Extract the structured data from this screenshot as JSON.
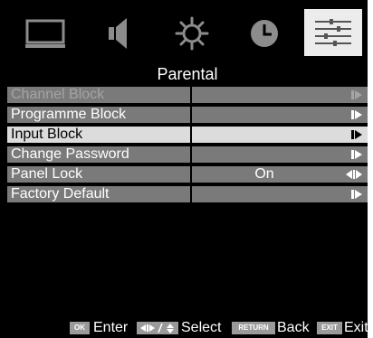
{
  "tabs": [
    {
      "icon": "picture-icon",
      "active": false
    },
    {
      "icon": "sound-icon",
      "active": false
    },
    {
      "icon": "settings-icon",
      "active": false
    },
    {
      "icon": "clock-icon",
      "active": false
    },
    {
      "icon": "options-icon",
      "active": true
    }
  ],
  "title": "Parental",
  "menu": {
    "items": [
      {
        "label": "Channel Block",
        "value": "",
        "state": "disabled"
      },
      {
        "label": "Programme Block",
        "value": "",
        "state": "normal"
      },
      {
        "label": "Input Block",
        "value": "",
        "state": "selected"
      },
      {
        "label": "Change Password",
        "value": "",
        "state": "normal"
      },
      {
        "label": "Panel Lock",
        "value": "On",
        "state": "normal"
      },
      {
        "label": "Factory Default",
        "value": "",
        "state": "normal"
      }
    ]
  },
  "help": {
    "ok_key": "OK",
    "enter": "Enter",
    "select": "Select",
    "return_key": "RETURN",
    "back": "Back",
    "exit_key": "EXIT",
    "exit": "Exit"
  },
  "colors": {
    "background": "#000000",
    "row_fill": "#7a7a7a",
    "row_selected": "#dcdcdc",
    "active_tab": "#ececec"
  }
}
